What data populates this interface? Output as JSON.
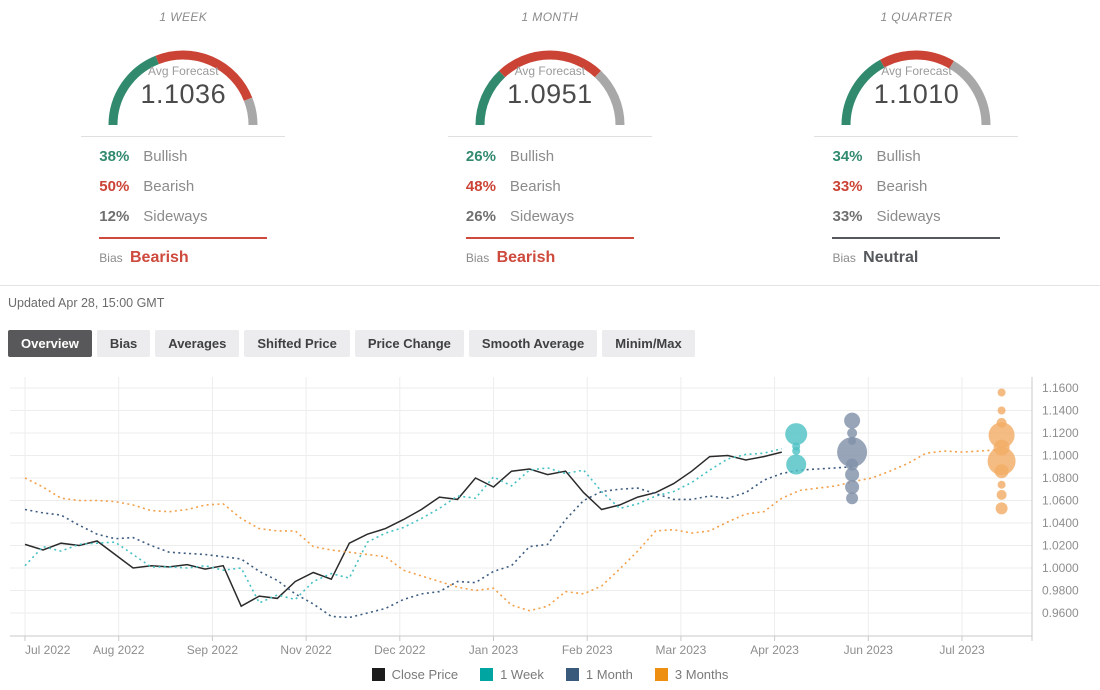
{
  "colors": {
    "bullish": "#328a6e",
    "bearish": "#cb4335",
    "sideways": "#a8a8a8",
    "sideways_text": "#6f6f6f",
    "axis_line": "#c9c9c9",
    "gridline": "#ededed",
    "tick_label": "#8e8e8e"
  },
  "forecast": {
    "panels": [
      {
        "title": "1 WEEK",
        "avg_label": "Avg Forecast",
        "avg_value": "1.1036",
        "stats": [
          {
            "kind": "bullish",
            "pct": 38,
            "pct_label": "38%",
            "label": "Bullish"
          },
          {
            "kind": "bearish",
            "pct": 50,
            "pct_label": "50%",
            "label": "Bearish"
          },
          {
            "kind": "sideways",
            "pct": 12,
            "pct_label": "12%",
            "label": "Sideways"
          }
        ],
        "bias_label": "Bias",
        "bias_value": "Bearish",
        "bias_color": "#cd4a3c"
      },
      {
        "title": "1 MONTH",
        "avg_label": "Avg Forecast",
        "avg_value": "1.0951",
        "stats": [
          {
            "kind": "bullish",
            "pct": 26,
            "pct_label": "26%",
            "label": "Bullish"
          },
          {
            "kind": "bearish",
            "pct": 48,
            "pct_label": "48%",
            "label": "Bearish"
          },
          {
            "kind": "sideways",
            "pct": 26,
            "pct_label": "26%",
            "label": "Sideways"
          }
        ],
        "bias_label": "Bias",
        "bias_value": "Bearish",
        "bias_color": "#cd4a3c"
      },
      {
        "title": "1 QUARTER",
        "avg_label": "Avg Forecast",
        "avg_value": "1.1010",
        "stats": [
          {
            "kind": "bullish",
            "pct": 34,
            "pct_label": "34%",
            "label": "Bullish"
          },
          {
            "kind": "bearish",
            "pct": 33,
            "pct_label": "33%",
            "label": "Bearish"
          },
          {
            "kind": "sideways",
            "pct": 33,
            "pct_label": "33%",
            "label": "Sideways"
          }
        ],
        "bias_label": "Bias",
        "bias_value": "Neutral",
        "bias_color": "#55585c"
      }
    ]
  },
  "updated": "Updated Apr 28, 15:00 GMT",
  "tabs": [
    {
      "label": "Overview",
      "active": true
    },
    {
      "label": "Bias",
      "active": false
    },
    {
      "label": "Averages",
      "active": false
    },
    {
      "label": "Shifted Price",
      "active": false
    },
    {
      "label": "Price Change",
      "active": false
    },
    {
      "label": "Smooth Average",
      "active": false
    },
    {
      "label": "Minim/Max",
      "active": false
    }
  ],
  "chart_data": {
    "type": "line",
    "title": "",
    "xlabel": "",
    "ylabel": "",
    "grid": true,
    "legend_position": "bottom",
    "ylim": [
      0.96,
      1.16
    ],
    "y_tick_step": 0.02,
    "y_tick_labels": [
      "1.1600",
      "1.1400",
      "1.1200",
      "1.1000",
      "1.0800",
      "1.0600",
      "1.0400",
      "1.0200",
      "1.0000",
      "0.9800",
      "0.9600"
    ],
    "x_tick_labels": [
      "Jul 2022",
      "Aug 2022",
      "Sep 2022",
      "Nov 2022",
      "Dec 2022",
      "Jan 2023",
      "Feb 2023",
      "Mar 2023",
      "Apr 2023",
      "Jun 2023",
      "Jul 2023"
    ],
    "x_unit": "week",
    "weeks_per_tick": 5.2,
    "series": [
      {
        "name": "Close Price",
        "color": "#1c1c1c",
        "line_color": "#2b2b2b",
        "style": "solid",
        "values": [
          1.021,
          1.016,
          1.022,
          1.02,
          1.024,
          1.012,
          1.0,
          1.002,
          1.001,
          1.003,
          0.999,
          1.002,
          0.966,
          0.975,
          0.973,
          0.988,
          0.996,
          0.99,
          1.022,
          1.03,
          1.035,
          1.043,
          1.052,
          1.063,
          1.061,
          1.08,
          1.072,
          1.086,
          1.088,
          1.083,
          1.086,
          1.067,
          1.052,
          1.056,
          1.063,
          1.067,
          1.075,
          1.086,
          1.099,
          1.1,
          1.096,
          1.099,
          1.103
        ]
      },
      {
        "name": "1 Week",
        "color": "#00a5a2",
        "line_color": "#46c1c3",
        "style": "dotted",
        "values": [
          1.002,
          1.019,
          1.015,
          1.021,
          1.022,
          1.023,
          1.012,
          1.001,
          1.001,
          1.0,
          1.002,
          0.998,
          1.0,
          0.969,
          0.976,
          0.972,
          0.988,
          0.995,
          0.991,
          1.023,
          1.031,
          1.036,
          1.044,
          1.053,
          1.064,
          1.062,
          1.081,
          1.073,
          1.087,
          1.089,
          1.084,
          1.087,
          1.068,
          1.053,
          1.057,
          1.064,
          1.068,
          1.076,
          1.087,
          1.097,
          1.101,
          1.102,
          1.106
        ]
      },
      {
        "name": "1 Month",
        "color": "#3a5a7c",
        "line_color": "#3d5c80",
        "style": "dotted",
        "values": [
          1.052,
          1.049,
          1.047,
          1.038,
          1.03,
          1.026,
          1.027,
          1.02,
          1.014,
          1.013,
          1.012,
          1.01,
          1.008,
          0.997,
          0.989,
          0.977,
          0.968,
          0.957,
          0.956,
          0.96,
          0.964,
          0.972,
          0.977,
          0.979,
          0.988,
          0.987,
          0.997,
          1.002,
          1.019,
          1.021,
          1.043,
          1.06,
          1.068,
          1.07,
          1.071,
          1.066,
          1.061,
          1.061,
          1.064,
          1.062,
          1.067,
          1.078,
          1.084,
          1.087,
          1.088,
          1.089,
          1.09
        ]
      },
      {
        "name": "3 Months",
        "color": "#ee8f12",
        "line_color": "#f3a04a",
        "style": "dotted",
        "values": [
          1.08,
          1.072,
          1.062,
          1.06,
          1.06,
          1.059,
          1.056,
          1.051,
          1.05,
          1.052,
          1.056,
          1.057,
          1.044,
          1.035,
          1.033,
          1.033,
          1.019,
          1.016,
          1.014,
          1.012,
          1.01,
          0.998,
          0.993,
          0.988,
          0.983,
          0.98,
          0.982,
          0.967,
          0.962,
          0.966,
          0.979,
          0.977,
          0.984,
          0.999,
          1.015,
          1.033,
          1.034,
          1.031,
          1.033,
          1.041,
          1.048,
          1.05,
          1.062,
          1.069,
          1.071,
          1.073,
          1.077,
          1.08,
          1.086,
          1.093,
          1.102,
          1.104,
          1.103,
          1.104,
          1.105
        ]
      }
    ],
    "bubble_clusters": [
      {
        "series": "1 Week",
        "color": "#4fc2c4",
        "week": 42.8,
        "points": [
          {
            "value": 1.119,
            "r": 11
          },
          {
            "value": 1.108,
            "r": 4
          },
          {
            "value": 1.104,
            "r": 4
          },
          {
            "value": 1.092,
            "r": 10
          }
        ]
      },
      {
        "series": "1 Month",
        "color": "#8191a9",
        "week": 45.9,
        "points": [
          {
            "value": 1.131,
            "r": 8
          },
          {
            "value": 1.12,
            "r": 5
          },
          {
            "value": 1.113,
            "r": 4
          },
          {
            "value": 1.103,
            "r": 15
          },
          {
            "value": 1.092,
            "r": 6
          },
          {
            "value": 1.083,
            "r": 7
          },
          {
            "value": 1.072,
            "r": 7
          },
          {
            "value": 1.062,
            "r": 6
          }
        ]
      },
      {
        "series": "3 Months",
        "color": "#f2ad66",
        "week": 54.2,
        "points": [
          {
            "value": 1.156,
            "r": 4
          },
          {
            "value": 1.14,
            "r": 4
          },
          {
            "value": 1.129,
            "r": 5
          },
          {
            "value": 1.118,
            "r": 13
          },
          {
            "value": 1.107,
            "r": 8
          },
          {
            "value": 1.095,
            "r": 14
          },
          {
            "value": 1.086,
            "r": 7
          },
          {
            "value": 1.074,
            "r": 4
          },
          {
            "value": 1.065,
            "r": 5
          },
          {
            "value": 1.053,
            "r": 6
          }
        ]
      }
    ]
  }
}
